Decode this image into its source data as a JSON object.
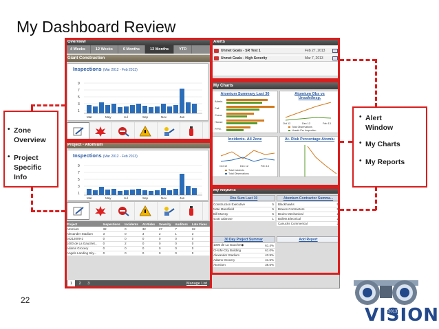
{
  "slide": {
    "title": "My Dashboard Review",
    "number": "22"
  },
  "left_callout": {
    "items": [
      "Zone Overview",
      "Project Specific Info"
    ]
  },
  "right_callout": {
    "items": [
      "Alert Window",
      "My Charts",
      "My Reports"
    ]
  },
  "overview": {
    "header": "Overview",
    "tabs": [
      "4 Weeks",
      "12 Weeks",
      "6 Months",
      "12 Months",
      "YTD"
    ],
    "active_tab": "12 Months",
    "zone_title": "Giant Construction",
    "chart1": {
      "title": "Inspections",
      "subtitle": "(Mar 2012 - Feb 2013)",
      "y_ticks": [
        "9",
        "7",
        "5",
        "3",
        "1"
      ],
      "x_labels": [
        "Mar",
        "May",
        "Jul",
        "Sep",
        "Nov",
        "Jan"
      ]
    },
    "project_title": "Project - Atomium",
    "chart2": {
      "title": "Inspections",
      "subtitle": "(Mar 2012 - Feb 2013)",
      "y_ticks": [
        "9",
        "7",
        "5",
        "3",
        "1"
      ],
      "x_labels": [
        "Mar",
        "May",
        "Jul",
        "Sep",
        "Nov",
        "Jan"
      ]
    },
    "table": {
      "headers": [
        "Project",
        "Inspections",
        "Incidents",
        "At-Risks",
        "Severity",
        "Auditors",
        "Late Fixes"
      ],
      "rows": [
        [
          "Atomium",
          "32",
          "0",
          "32",
          "27",
          "7",
          "32"
        ],
        [
          "Alexander Stadium",
          "3",
          "0",
          "3",
          "2",
          "1",
          "3"
        ],
        [
          "04212009-2",
          "0",
          "0",
          "0",
          "0",
          "0",
          "0"
        ],
        [
          "1000 de La Gauchet...",
          "0",
          "2",
          "0",
          "0",
          "0",
          "0"
        ],
        [
          "Adams Grocery",
          "0",
          "0",
          "0",
          "0",
          "0",
          "0"
        ],
        [
          "Angels Landing Sky...",
          "0",
          "0",
          "0",
          "0",
          "0",
          "0"
        ]
      ]
    },
    "pager": {
      "pages": [
        "1",
        "2",
        "3"
      ],
      "manage": "Manage List"
    }
  },
  "alerts": {
    "header": "Alerts",
    "rows": [
      {
        "name": "Unmet Goals - SR Test 1",
        "date": "Feb 27, 2013"
      },
      {
        "name": "Unmet Goals - High Severity",
        "date": "Mar 7, 2013"
      }
    ]
  },
  "my_charts": {
    "header": "My Charts",
    "summary": {
      "title": "Atomium Summary Last 30",
      "categories": [
        "Admin",
        "Fall",
        "Crane",
        "House",
        "P.P.E."
      ]
    },
    "obs": {
      "title": "Atomium Obs vs Unsafe/Insp.",
      "x_labels": [
        "Oct 12",
        "Dec 12",
        "Feb 13"
      ],
      "legend": [
        "Total Observations",
        "Unsafe Per Inspection"
      ]
    },
    "incidents": {
      "title": "Incidents- All Zone",
      "x_labels": [
        "Oct 12",
        "Dec 12",
        "Feb 13"
      ],
      "legend": [
        "Total Incidents",
        "Total Observations"
      ]
    },
    "atrisk": {
      "title": "At- Risk Percentage  Atomiu"
    }
  },
  "my_reports": {
    "header": "My Reports",
    "obs_sum": {
      "title": "Obs Sum Last 30",
      "rows": [
        [
          "Construction Executive",
          "5"
        ],
        [
          "Nate Mansfield",
          "5"
        ],
        [
          "Bill Murray",
          "5"
        ],
        [
          "scott calarose",
          "1"
        ]
      ]
    },
    "contractor": {
      "title": "Atomium Contractor Summa...",
      "rows": [
        [
          "Blackhawks",
          "5"
        ],
        [
          "Braves Contractors",
          "5"
        ],
        [
          "Bruins Mechanical",
          "2"
        ],
        [
          "Bullets Electrical",
          "2"
        ],
        [
          "Canucks Commerical",
          "2"
        ]
      ]
    },
    "project_summary": {
      "title": "30 Day Project Summar",
      "rows": [
        [
          "1000 de La Gauchet◆",
          "61.4%"
        ],
        [
          "CHUM-City Building",
          "61.0%"
        ],
        [
          "Alexander Stadium",
          "43.9%"
        ],
        [
          "Adams Grocery",
          "41.5%"
        ],
        [
          "Atomium",
          "36.6%"
        ]
      ]
    },
    "add_report": "Add Report"
  },
  "logo": {
    "text": "VISION",
    "year": "2013"
  }
}
